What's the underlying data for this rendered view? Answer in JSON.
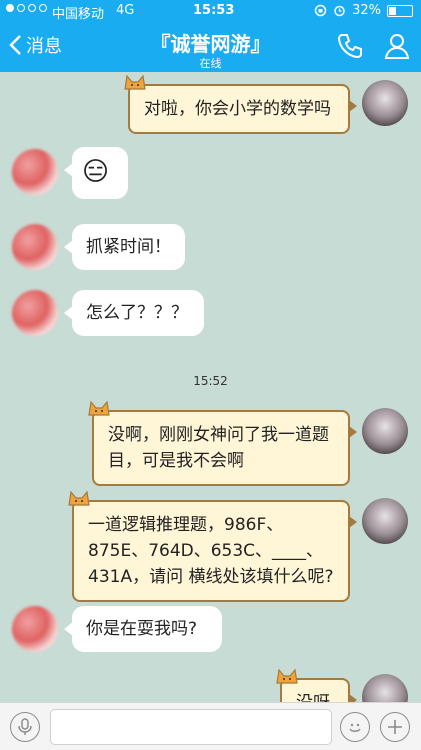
{
  "status": {
    "carrier": "中国移动",
    "network": "4G",
    "time": "15:53",
    "battery": "32%",
    "battery_level": 0.32
  },
  "nav": {
    "back_label": "消息",
    "title": "『诚誉网游』",
    "subtitle": "在线"
  },
  "messages": [
    {
      "side": "out",
      "text": "对啦，你会小学的数学吗"
    },
    {
      "side": "in",
      "text": "😑"
    },
    {
      "side": "in",
      "text": "抓紧时间！"
    },
    {
      "side": "in",
      "text": "怎么了？？？"
    },
    {
      "side": "out",
      "text": "没啊，刚刚女神问了我一道题目，可是我不会啊"
    },
    {
      "side": "out",
      "text": "一道逻辑推理题，986F、875E、764D、653C、____、431A，请问 横线处该填什么呢?"
    },
    {
      "side": "in",
      "text": "你是在耍我吗?"
    },
    {
      "side": "out",
      "text": "没呀"
    }
  ],
  "timestamp": "15:52",
  "input": {
    "placeholder": ""
  },
  "colors": {
    "accent": "#19acf0",
    "chat_bg": "#c7dcd4",
    "out_bubble": "#fff6d8",
    "out_border": "#a47a3e"
  }
}
